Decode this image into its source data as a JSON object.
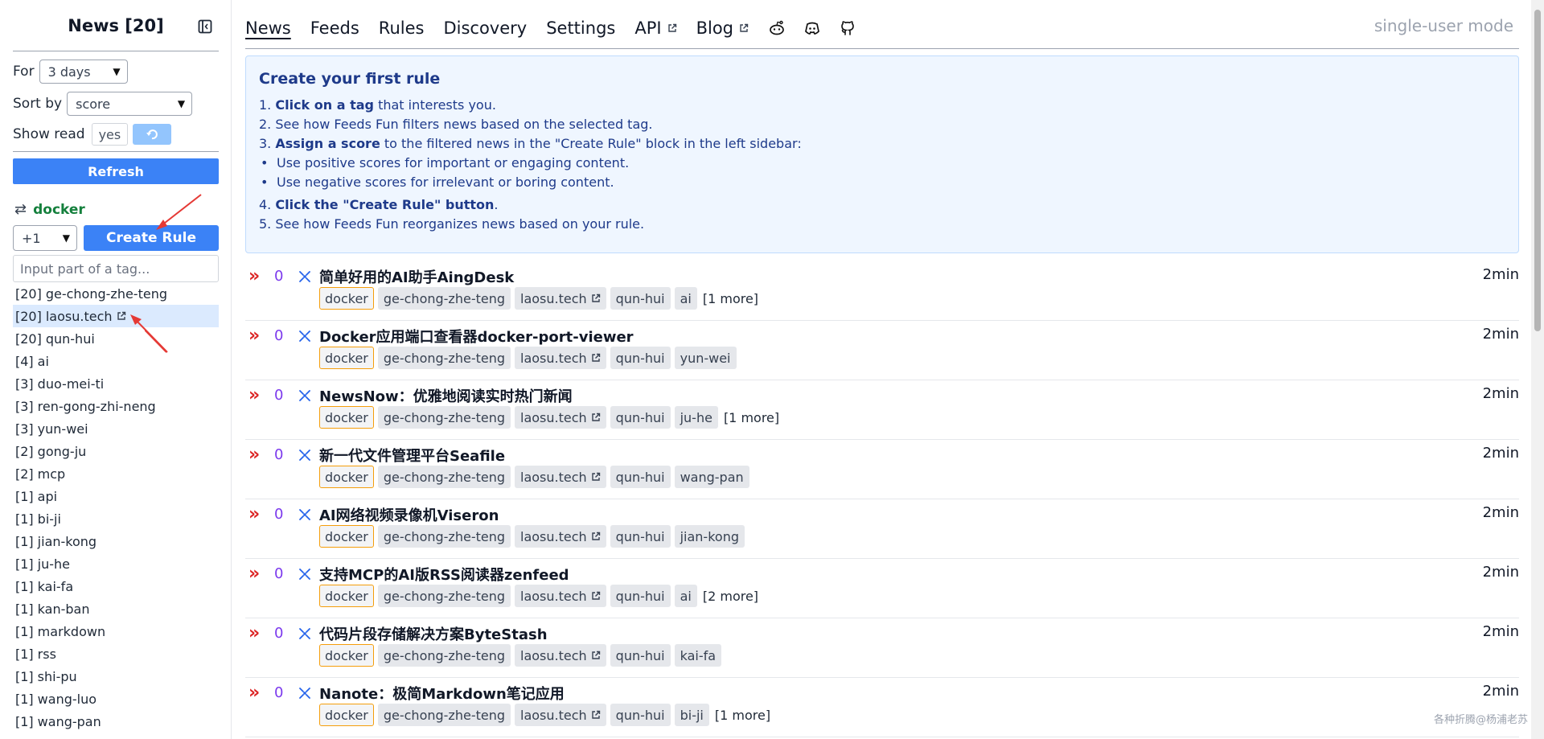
{
  "sidebar": {
    "title": "News [20]",
    "period_label": "For",
    "period_value": "3 days",
    "sort_label": "Sort by",
    "sort_value": "score",
    "show_read_label": "Show read",
    "show_read_value": "yes",
    "refresh_label": "Refresh",
    "selected_tag": "docker",
    "score_value": "+1",
    "create_rule_label": "Create Rule",
    "tag_input_placeholder": "Input part of a tag...",
    "tags": [
      {
        "count": "[20]",
        "name": "ge-chong-zhe-teng"
      },
      {
        "count": "[20]",
        "name": "laosu.tech",
        "external": true,
        "highlight": true
      },
      {
        "count": "[20]",
        "name": "qun-hui"
      },
      {
        "count": "[4]",
        "name": "ai"
      },
      {
        "count": "[3]",
        "name": "duo-mei-ti"
      },
      {
        "count": "[3]",
        "name": "ren-gong-zhi-neng"
      },
      {
        "count": "[3]",
        "name": "yun-wei"
      },
      {
        "count": "[2]",
        "name": "gong-ju"
      },
      {
        "count": "[2]",
        "name": "mcp"
      },
      {
        "count": "[1]",
        "name": "api"
      },
      {
        "count": "[1]",
        "name": "bi-ji"
      },
      {
        "count": "[1]",
        "name": "jian-kong"
      },
      {
        "count": "[1]",
        "name": "ju-he"
      },
      {
        "count": "[1]",
        "name": "kai-fa"
      },
      {
        "count": "[1]",
        "name": "kan-ban"
      },
      {
        "count": "[1]",
        "name": "markdown"
      },
      {
        "count": "[1]",
        "name": "rss"
      },
      {
        "count": "[1]",
        "name": "shi-pu"
      },
      {
        "count": "[1]",
        "name": "wang-luo"
      },
      {
        "count": "[1]",
        "name": "wang-pan"
      }
    ]
  },
  "nav": {
    "items": [
      {
        "label": "News",
        "active": true
      },
      {
        "label": "Feeds"
      },
      {
        "label": "Rules"
      },
      {
        "label": "Discovery"
      },
      {
        "label": "Settings"
      },
      {
        "label": "API",
        "external": true
      },
      {
        "label": "Blog",
        "external": true
      }
    ],
    "icons": [
      "reddit-icon",
      "discord-icon",
      "github-icon"
    ],
    "mode": "single-user mode"
  },
  "info": {
    "title": "Create your first rule",
    "steps": [
      {
        "num": "1.",
        "bold": "Click on a tag",
        "rest": " that interests you."
      },
      {
        "num": "2.",
        "bold": "",
        "rest": "See how Feeds Fun filters news based on the selected tag."
      },
      {
        "num": "3.",
        "bold": "Assign a score",
        "rest": " to the filtered news in the \"Create Rule\" block in the left sidebar:"
      },
      {
        "bullet": "Use positive scores for important or engaging content."
      },
      {
        "bullet": "Use negative scores for irrelevant or boring content."
      },
      {
        "num": "4.",
        "bold": "Click the \"Create Rule\" button",
        "rest": "."
      },
      {
        "num": "5.",
        "bold": "",
        "rest": "See how Feeds Fun reorganizes news based on your rule."
      }
    ]
  },
  "news": [
    {
      "score": "0",
      "title": "简单好用的AI助手AingDesk",
      "time": "2min",
      "tags": [
        "docker",
        "ge-chong-zhe-teng",
        "laosu.tech",
        "qun-hui",
        "ai"
      ],
      "more": "[1 more]"
    },
    {
      "score": "0",
      "title": "Docker应用端口查看器docker-port-viewer",
      "time": "2min",
      "tags": [
        "docker",
        "ge-chong-zhe-teng",
        "laosu.tech",
        "qun-hui",
        "yun-wei"
      ],
      "more": ""
    },
    {
      "score": "0",
      "title": "NewsNow：优雅地阅读实时热门新闻",
      "time": "2min",
      "tags": [
        "docker",
        "ge-chong-zhe-teng",
        "laosu.tech",
        "qun-hui",
        "ju-he"
      ],
      "more": "[1 more]"
    },
    {
      "score": "0",
      "title": "新一代文件管理平台Seafile",
      "time": "2min",
      "tags": [
        "docker",
        "ge-chong-zhe-teng",
        "laosu.tech",
        "qun-hui",
        "wang-pan"
      ],
      "more": ""
    },
    {
      "score": "0",
      "title": "AI网络视频录像机Viseron",
      "time": "2min",
      "tags": [
        "docker",
        "ge-chong-zhe-teng",
        "laosu.tech",
        "qun-hui",
        "jian-kong"
      ],
      "more": ""
    },
    {
      "score": "0",
      "title": "支持MCP的AI版RSS阅读器zenfeed",
      "time": "2min",
      "tags": [
        "docker",
        "ge-chong-zhe-teng",
        "laosu.tech",
        "qun-hui",
        "ai"
      ],
      "more": "[2 more]"
    },
    {
      "score": "0",
      "title": "代码片段存储解决方案ByteStash",
      "time": "2min",
      "tags": [
        "docker",
        "ge-chong-zhe-teng",
        "laosu.tech",
        "qun-hui",
        "kai-fa"
      ],
      "more": ""
    },
    {
      "score": "0",
      "title": "Nanote：极简Markdown笔记应用",
      "time": "2min",
      "tags": [
        "docker",
        "ge-chong-zhe-teng",
        "laosu.tech",
        "qun-hui",
        "bi-ji"
      ],
      "more": "[1 more]"
    }
  ],
  "external_tag": "laosu.tech",
  "colors": {
    "accent": "#3b82f6",
    "selected_tag": "#15803d",
    "score": "#7c3aed",
    "chevron": "#dc2626",
    "annotation": "#e53935"
  },
  "watermark": "各种折腾@杨浦老苏"
}
